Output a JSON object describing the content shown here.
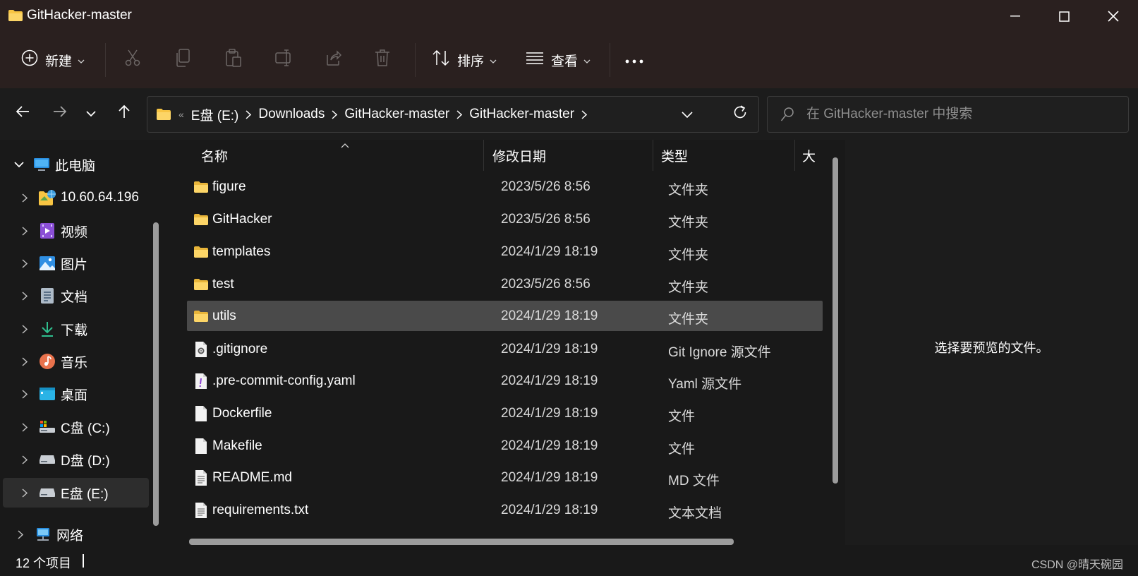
{
  "window": {
    "title": "GitHacker-master"
  },
  "toolbar": {
    "new_label": "新建",
    "sort_label": "排序",
    "view_label": "查看",
    "icons": [
      "cut-icon",
      "copy-icon",
      "paste-icon",
      "rename-icon",
      "share-icon",
      "delete-icon"
    ]
  },
  "address": {
    "overflow": "«",
    "crumbs": [
      "E盘 (E:)",
      "Downloads",
      "GitHacker-master",
      "GitHacker-master"
    ]
  },
  "search": {
    "placeholder": "在 GitHacker-master 中搜索"
  },
  "nav": {
    "items": [
      {
        "label": "此电脑",
        "icon": "this-pc-icon",
        "expanded": true
      },
      {
        "label": "10.60.64.196",
        "icon": "network-drive-icon"
      },
      {
        "label": "视频",
        "icon": "videos-icon"
      },
      {
        "label": "图片",
        "icon": "pictures-icon"
      },
      {
        "label": "文档",
        "icon": "documents-icon"
      },
      {
        "label": "下载",
        "icon": "downloads-icon"
      },
      {
        "label": "音乐",
        "icon": "music-icon"
      },
      {
        "label": "桌面",
        "icon": "desktop-icon"
      },
      {
        "label": "C盘 (C:)",
        "icon": "drive-c-icon"
      },
      {
        "label": "D盘 (D:)",
        "icon": "drive-d-icon"
      },
      {
        "label": "E盘 (E:)",
        "icon": "drive-e-icon",
        "selected": true
      },
      {
        "label": "网络",
        "icon": "network-icon"
      }
    ]
  },
  "columns": {
    "name": "名称",
    "date": "修改日期",
    "type": "类型",
    "size": "大"
  },
  "files": [
    {
      "name": "figure",
      "date": "2023/5/26 8:56",
      "type": "文件夹",
      "icon": "folder-icon"
    },
    {
      "name": "GitHacker",
      "date": "2023/5/26 8:56",
      "type": "文件夹",
      "icon": "folder-icon"
    },
    {
      "name": "templates",
      "date": "2024/1/29 18:19",
      "type": "文件夹",
      "icon": "folder-icon"
    },
    {
      "name": "test",
      "date": "2023/5/26 8:56",
      "type": "文件夹",
      "icon": "folder-icon"
    },
    {
      "name": "utils",
      "date": "2024/1/29 18:19",
      "type": "文件夹",
      "icon": "folder-icon",
      "selected": true
    },
    {
      "name": ".gitignore",
      "date": "2024/1/29 18:19",
      "type": "Git Ignore 源文件",
      "icon": "settings-file-icon"
    },
    {
      "name": ".pre-commit-config.yaml",
      "date": "2024/1/29 18:19",
      "type": "Yaml 源文件",
      "icon": "yaml-file-icon"
    },
    {
      "name": "Dockerfile",
      "date": "2024/1/29 18:19",
      "type": "文件",
      "icon": "file-icon"
    },
    {
      "name": "Makefile",
      "date": "2024/1/29 18:19",
      "type": "文件",
      "icon": "file-icon"
    },
    {
      "name": "README.md",
      "date": "2024/1/29 18:19",
      "type": "MD 文件",
      "icon": "text-file-icon"
    },
    {
      "name": "requirements.txt",
      "date": "2024/1/29 18:19",
      "type": "文本文档",
      "icon": "text-file-icon"
    }
  ],
  "preview": {
    "message": "选择要预览的文件。"
  },
  "status": {
    "item_count": "12 个项目"
  },
  "watermark": "CSDN @晴天碗园",
  "colors": {
    "chrome": "#2a201f",
    "background": "#191919",
    "selection": "#4a4a4a",
    "folder": "#f8c543"
  }
}
